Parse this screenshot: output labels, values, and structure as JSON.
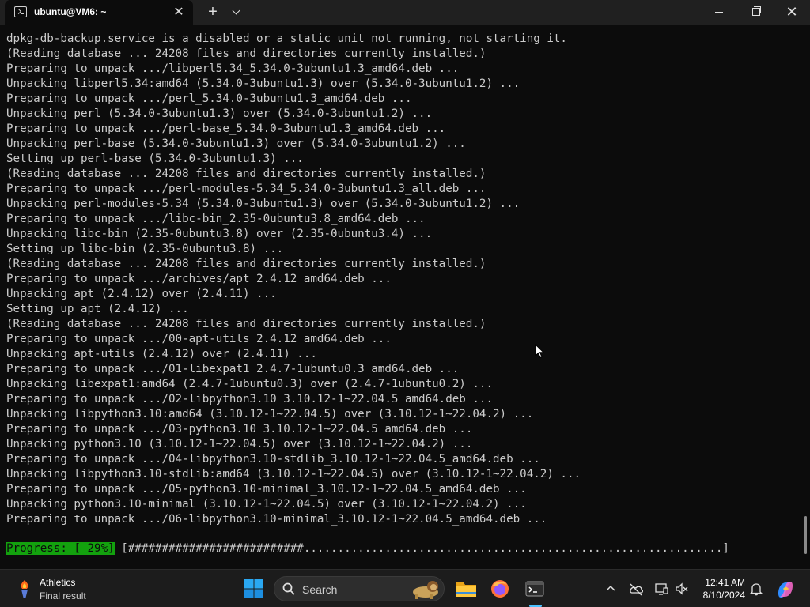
{
  "window": {
    "tab_title": "ubuntu@VM6: ~",
    "new_tab_label": "+",
    "close_tab_label": "✕",
    "close_window_label": "✕"
  },
  "terminal": {
    "lines": [
      "dpkg-db-backup.service is a disabled or a static unit not running, not starting it.",
      "(Reading database ... 24208 files and directories currently installed.)",
      "Preparing to unpack .../libperl5.34_5.34.0-3ubuntu1.3_amd64.deb ...",
      "Unpacking libperl5.34:amd64 (5.34.0-3ubuntu1.3) over (5.34.0-3ubuntu1.2) ...",
      "Preparing to unpack .../perl_5.34.0-3ubuntu1.3_amd64.deb ...",
      "Unpacking perl (5.34.0-3ubuntu1.3) over (5.34.0-3ubuntu1.2) ...",
      "Preparing to unpack .../perl-base_5.34.0-3ubuntu1.3_amd64.deb ...",
      "Unpacking perl-base (5.34.0-3ubuntu1.3) over (5.34.0-3ubuntu1.2) ...",
      "Setting up perl-base (5.34.0-3ubuntu1.3) ...",
      "(Reading database ... 24208 files and directories currently installed.)",
      "Preparing to unpack .../perl-modules-5.34_5.34.0-3ubuntu1.3_all.deb ...",
      "Unpacking perl-modules-5.34 (5.34.0-3ubuntu1.3) over (5.34.0-3ubuntu1.2) ...",
      "Preparing to unpack .../libc-bin_2.35-0ubuntu3.8_amd64.deb ...",
      "Unpacking libc-bin (2.35-0ubuntu3.8) over (2.35-0ubuntu3.4) ...",
      "Setting up libc-bin (2.35-0ubuntu3.8) ...",
      "(Reading database ... 24208 files and directories currently installed.)",
      "Preparing to unpack .../archives/apt_2.4.12_amd64.deb ...",
      "Unpacking apt (2.4.12) over (2.4.11) ...",
      "Setting up apt (2.4.12) ...",
      "(Reading database ... 24208 files and directories currently installed.)",
      "Preparing to unpack .../00-apt-utils_2.4.12_amd64.deb ...",
      "Unpacking apt-utils (2.4.12) over (2.4.11) ...",
      "Preparing to unpack .../01-libexpat1_2.4.7-1ubuntu0.3_amd64.deb ...",
      "Unpacking libexpat1:amd64 (2.4.7-1ubuntu0.3) over (2.4.7-1ubuntu0.2) ...",
      "Preparing to unpack .../02-libpython3.10_3.10.12-1~22.04.5_amd64.deb ...",
      "Unpacking libpython3.10:amd64 (3.10.12-1~22.04.5) over (3.10.12-1~22.04.2) ...",
      "Preparing to unpack .../03-python3.10_3.10.12-1~22.04.5_amd64.deb ...",
      "Unpacking python3.10 (3.10.12-1~22.04.5) over (3.10.12-1~22.04.2) ...",
      "Preparing to unpack .../04-libpython3.10-stdlib_3.10.12-1~22.04.5_amd64.deb ...",
      "Unpacking libpython3.10-stdlib:amd64 (3.10.12-1~22.04.5) over (3.10.12-1~22.04.2) ...",
      "Preparing to unpack .../05-python3.10-minimal_3.10.12-1~22.04.5_amd64.deb ...",
      "Unpacking python3.10-minimal (3.10.12-1~22.04.5) over (3.10.12-1~22.04.2) ...",
      "Preparing to unpack .../06-libpython3.10-minimal_3.10.12-1~22.04.5_amd64.deb ..."
    ],
    "progress_label": "Progress: [ 29%]",
    "progress_bar": " [##########################..............................................................]",
    "progress_percent": 29
  },
  "taskbar": {
    "widget_title": "Athletics",
    "widget_subtitle": "Final result",
    "search_placeholder": "Search",
    "time": "12:41 AM",
    "date": "8/10/2024"
  },
  "colors": {
    "terminal_bg": "#0c0c0c",
    "terminal_text": "#cccccc",
    "progress_green": "#13a10e",
    "taskbar_bg": "#1c1c1c",
    "accent": "#4cc2ff"
  }
}
